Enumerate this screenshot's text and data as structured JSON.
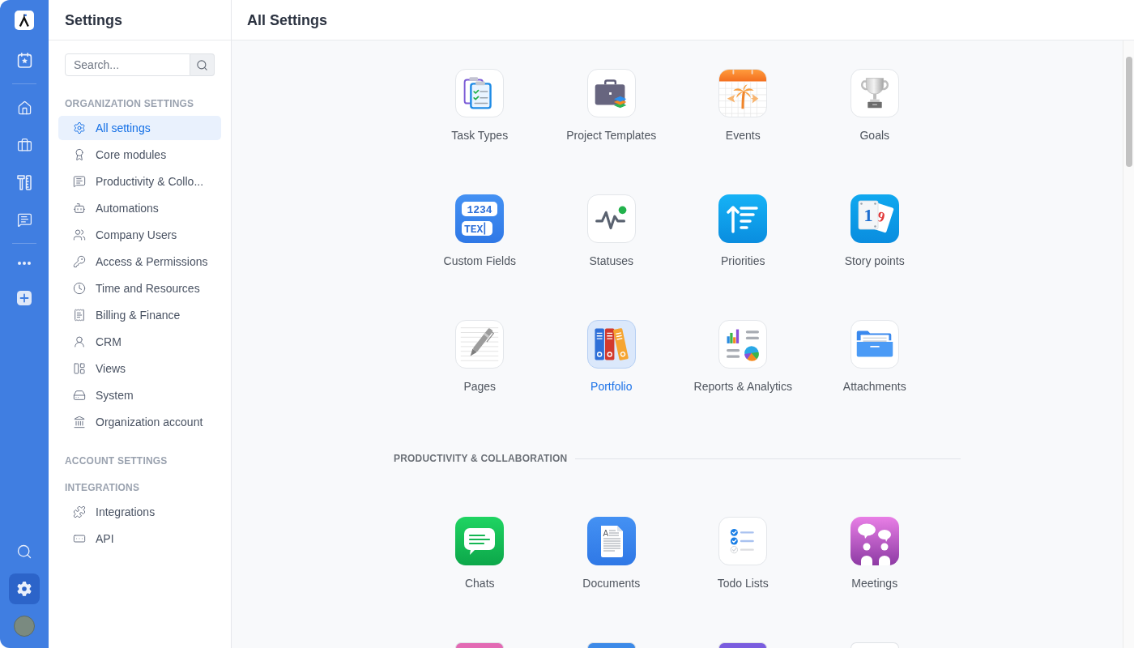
{
  "rail": {
    "items": [
      {
        "selected": false
      },
      {
        "selected": false
      },
      {
        "selected": false
      },
      {
        "selected": false
      },
      {
        "selected": false
      },
      {
        "selected": false
      },
      {
        "selected": false
      }
    ],
    "bottom": [
      {
        "selected": false
      },
      {
        "selected": true
      }
    ]
  },
  "sidebar": {
    "title": "Settings",
    "search": {
      "placeholder": "Search..."
    },
    "groups": [
      {
        "heading": "ORGANIZATION SETTINGS",
        "items": [
          {
            "label": "All settings",
            "selected": true
          },
          {
            "label": "Core modules",
            "selected": false
          },
          {
            "label": "Productivity & Collo...",
            "selected": false
          },
          {
            "label": "Automations",
            "selected": false
          },
          {
            "label": "Company Users",
            "selected": false
          },
          {
            "label": "Access & Permissions",
            "selected": false
          },
          {
            "label": "Time and Resources",
            "selected": false
          },
          {
            "label": "Billing & Finance",
            "selected": false
          },
          {
            "label": "CRM",
            "selected": false
          },
          {
            "label": "Views",
            "selected": false
          },
          {
            "label": "System",
            "selected": false
          },
          {
            "label": "Organization account",
            "selected": false
          }
        ]
      },
      {
        "heading": "ACCOUNT SETTINGS"
      },
      {
        "heading": "INTEGRATIONS",
        "items": [
          {
            "label": "Integrations",
            "selected": false
          },
          {
            "label": "API",
            "selected": false
          }
        ]
      }
    ]
  },
  "main": {
    "title": "All Settings",
    "sections": [
      {
        "items": [
          {
            "label": "Task Types",
            "selected": false
          },
          {
            "label": "Project Templates",
            "selected": false
          },
          {
            "label": "Events",
            "selected": false
          },
          {
            "label": "Goals",
            "selected": false
          },
          {
            "label": "Custom Fields",
            "selected": false,
            "icon_text": [
              "1234",
              "TEX"
            ]
          },
          {
            "label": "Statuses",
            "selected": false
          },
          {
            "label": "Priorities",
            "selected": false
          },
          {
            "label": "Story points",
            "selected": false,
            "icon_text": [
              "1",
              "9"
            ]
          },
          {
            "label": "Pages",
            "selected": false
          },
          {
            "label": "Portfolio",
            "selected": true
          },
          {
            "label": "Reports & Analytics",
            "selected": false
          },
          {
            "label": "Attachments",
            "selected": false
          }
        ]
      },
      {
        "heading": "PRODUCTIVITY & COLLABORATION",
        "items": [
          {
            "label": "Chats",
            "selected": false
          },
          {
            "label": "Documents",
            "selected": false,
            "icon_text": [
              "A"
            ]
          },
          {
            "label": "Todo Lists",
            "selected": false
          },
          {
            "label": "Meetings",
            "selected": false
          }
        ],
        "cut_items": [
          {
            "color": "#e36ab4"
          },
          {
            "color": "#3d8ae8"
          },
          {
            "color": "#7a5ddf"
          },
          {
            "color": "#ffffff"
          }
        ]
      }
    ]
  }
}
